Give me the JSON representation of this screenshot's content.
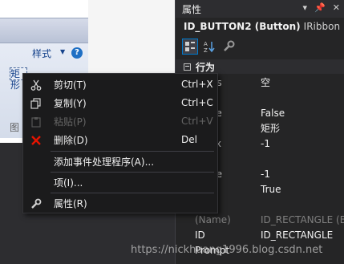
{
  "designer": {
    "style_label": "样式",
    "rect_button_label": "矩形",
    "stub_label": "图"
  },
  "properties_panel": {
    "title": "属性",
    "object_name": "ID_BUTTON2 (Button)",
    "object_type": "IRibbon",
    "category": "行为",
    "rows": [
      {
        "name": "Items",
        "value": "空"
      },
      {
        "name": "",
        "value": ""
      },
      {
        "name": "Large",
        "value": "False"
      },
      {
        "name": "n",
        "value": "矩形"
      },
      {
        "name": "Index",
        "value": "-1"
      },
      {
        "name": "",
        "value": ""
      },
      {
        "name": "mage",
        "value": "-1"
      },
      {
        "name": "ode",
        "value": "True"
      },
      {
        "name": "",
        "value": ""
      },
      {
        "name": "(Name)",
        "value": "ID_RECTANGLE (B"
      },
      {
        "name": "ID",
        "value": "ID_RECTANGLE"
      },
      {
        "name": "Prompt",
        "value": ""
      }
    ]
  },
  "context_menu": {
    "items": [
      {
        "label": "剪切(T)",
        "shortcut": "Ctrl+X",
        "icon": "scissors-icon",
        "disabled": false
      },
      {
        "label": "复制(Y)",
        "shortcut": "Ctrl+C",
        "icon": "copy-icon",
        "disabled": false
      },
      {
        "label": "粘贴(P)",
        "shortcut": "Ctrl+V",
        "icon": "paste-icon",
        "disabled": true
      },
      {
        "label": "删除(D)",
        "shortcut": "Del",
        "icon": "delete-x-icon",
        "disabled": false
      },
      {
        "label": "添加事件处理程序(A)...",
        "shortcut": "",
        "icon": "",
        "disabled": false
      },
      {
        "label": "项(I)...",
        "shortcut": "",
        "icon": "",
        "disabled": false
      },
      {
        "label": "属性(R)",
        "shortcut": "",
        "icon": "wrench-icon",
        "disabled": false
      }
    ]
  },
  "watermark": "https://nickhuang1996.blog.csdn.net",
  "colors": {
    "accent": "#007acc",
    "delete": "#e51400",
    "menu_bg": "#1b1b1c",
    "panel_bg": "#252526"
  }
}
